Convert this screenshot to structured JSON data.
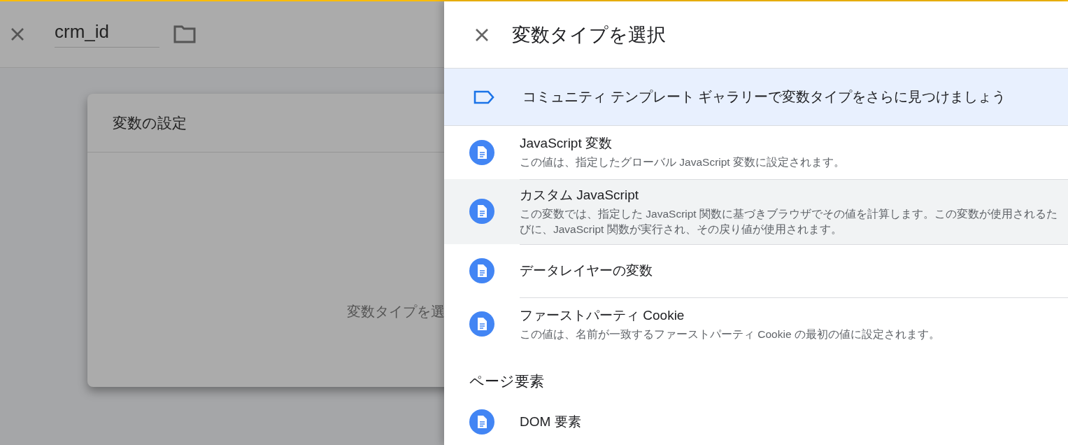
{
  "editor": {
    "name_value": "crm_id",
    "card_title": "変数の設定",
    "card_hint": "変数タイプを選"
  },
  "panel": {
    "title": "変数タイプを選択",
    "banner": "コミュニティ テンプレート ギャラリーで変数タイプをさらに見つけましょう",
    "items": [
      {
        "title": "JavaScript 変数",
        "description": "この値は、指定したグローバル JavaScript 変数に設定されます。",
        "highlighted": false
      },
      {
        "title": "カスタム JavaScript",
        "description": "この変数では、指定した JavaScript 関数に基づきブラウザでその値を計算します。この変数が使用されるたびに、JavaScript 関数が実行され、その戻り値が使用されます。",
        "highlighted": true
      },
      {
        "title": "データレイヤーの変数",
        "highlighted": false
      },
      {
        "title": "ファーストパーティ Cookie",
        "description": "この値は、名前が一致するファーストパーティ Cookie の最初の値に設定されます。",
        "highlighted": false
      }
    ],
    "section": "ページ要素",
    "section_items": [
      {
        "title": "DOM 要素",
        "highlighted": false
      }
    ]
  }
}
